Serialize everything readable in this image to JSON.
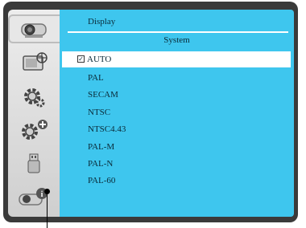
{
  "panel": {
    "title": "Display",
    "subtitle": "System"
  },
  "options": [
    {
      "label": "AUTO",
      "selected": true
    },
    {
      "label": "PAL",
      "selected": false
    },
    {
      "label": "SECAM",
      "selected": false
    },
    {
      "label": "NTSC",
      "selected": false
    },
    {
      "label": "NTSC4.43",
      "selected": false
    },
    {
      "label": "PAL-M",
      "selected": false
    },
    {
      "label": "PAL-N",
      "selected": false
    },
    {
      "label": "PAL-60",
      "selected": false
    }
  ],
  "checkmark": "✓",
  "sidebar": {
    "items": [
      {
        "icon": "projector-icon",
        "active": true
      },
      {
        "icon": "picture-settings-icon",
        "active": false
      },
      {
        "icon": "gear-icon",
        "active": false
      },
      {
        "icon": "gear-plus-icon",
        "active": false
      },
      {
        "icon": "usb-icon",
        "active": false
      },
      {
        "icon": "projector-info-icon",
        "active": false
      }
    ]
  },
  "colors": {
    "panel": "#3ec6ee",
    "frame": "#3a3a3a",
    "selected_row": "#ffffff"
  }
}
